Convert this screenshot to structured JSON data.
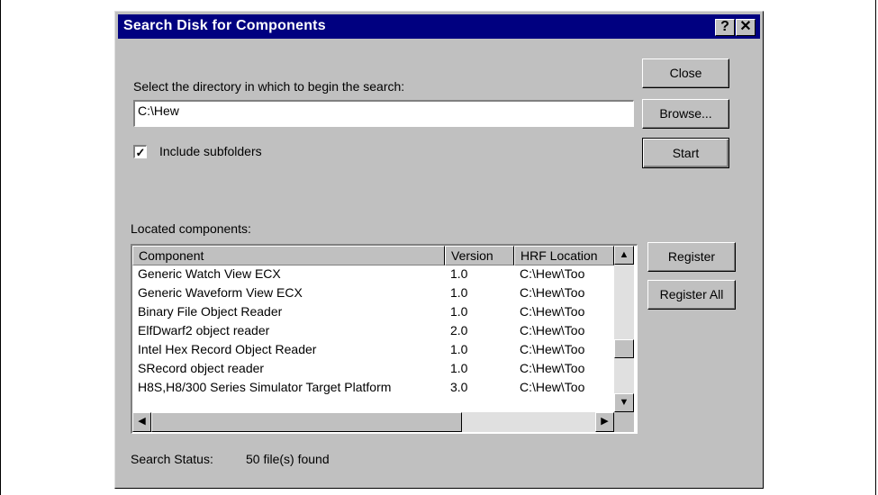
{
  "dialog": {
    "title": "Search Disk for Components",
    "help_glyph": "?",
    "close_glyph": "✕"
  },
  "directory": {
    "label": "Select the directory in which to begin the search:",
    "value": "C:\\Hew"
  },
  "subfolders": {
    "label": "Include subfolders",
    "checked_glyph": "✓"
  },
  "buttons": {
    "close": "Close",
    "browse": "Browse...",
    "start": "Start",
    "register": "Register",
    "register_all": "Register All"
  },
  "located": {
    "label": "Located components:",
    "columns": [
      "Component",
      "Version",
      "HRF Location"
    ],
    "rows": [
      [
        "Generic Watch View ECX",
        "1.0",
        "C:\\Hew\\Too"
      ],
      [
        "Generic Waveform View ECX",
        "1.0",
        "C:\\Hew\\Too"
      ],
      [
        "Binary File Object Reader",
        "1.0",
        "C:\\Hew\\Too"
      ],
      [
        "ElfDwarf2 object reader",
        "2.0",
        "C:\\Hew\\Too"
      ],
      [
        "Intel Hex Record Object Reader",
        "1.0",
        "C:\\Hew\\Too"
      ],
      [
        "SRecord object reader",
        "1.0",
        "C:\\Hew\\Too"
      ],
      [
        "H8S,H8/300 Series Simulator Target Platform",
        "3.0",
        "C:\\Hew\\Too"
      ]
    ]
  },
  "status": {
    "label": "Search Status:",
    "value": "50 file(s) found"
  },
  "icons": {
    "up": "▲",
    "down": "▼",
    "left": "◀",
    "right": "▶"
  }
}
